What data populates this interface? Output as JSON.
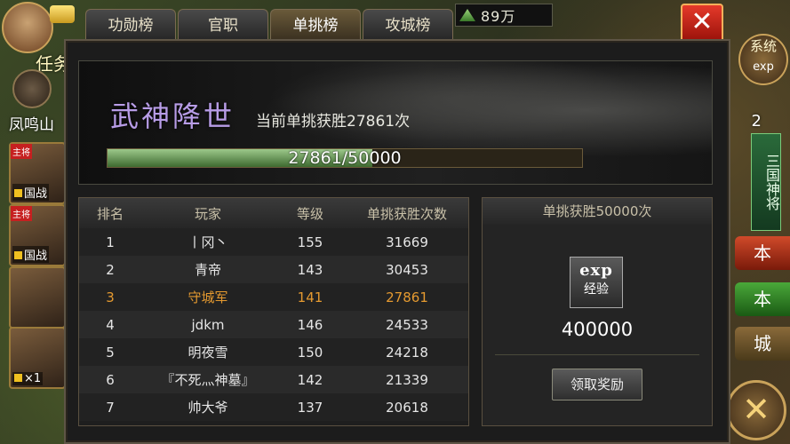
{
  "tabs": [
    {
      "label": "功勋榜",
      "active": false
    },
    {
      "label": "官职",
      "active": false
    },
    {
      "label": "单挑榜",
      "active": true
    },
    {
      "label": "攻城榜",
      "active": false
    }
  ],
  "resources": {
    "value": "89万"
  },
  "left_panel": {
    "task_label": "任务",
    "location": "凤鸣山"
  },
  "heroes": [
    {
      "badge": "主将",
      "tag": "国战"
    },
    {
      "badge": "主将",
      "tag": "国战"
    },
    {
      "badge": "",
      "tag": ""
    },
    {
      "badge": "",
      "tag": "×1"
    }
  ],
  "right_panel": {
    "system_label": "系统",
    "exp_label": "exp",
    "count": "2",
    "shen_jiang": "三国神将",
    "tabs": [
      "本",
      "本",
      "城"
    ]
  },
  "banner": {
    "title": "武神降世",
    "wins_text": "当前单挑获胜27861次",
    "progress": {
      "current": 27861,
      "max": 50000,
      "label": "27861/50000"
    }
  },
  "ranking": {
    "columns": [
      "排名",
      "玩家",
      "等级",
      "单挑获胜次数"
    ],
    "rows": [
      {
        "rank": "1",
        "player": "丨冈丶",
        "level": "155",
        "wins": "31669",
        "highlight": false
      },
      {
        "rank": "2",
        "player": "青帝",
        "level": "143",
        "wins": "30453",
        "highlight": false
      },
      {
        "rank": "3",
        "player": "守城军",
        "level": "141",
        "wins": "27861",
        "highlight": true
      },
      {
        "rank": "4",
        "player": "jdkm",
        "level": "146",
        "wins": "24533",
        "highlight": false
      },
      {
        "rank": "5",
        "player": "明夜雪",
        "level": "150",
        "wins": "24218",
        "highlight": false
      },
      {
        "rank": "6",
        "player": "『不死灬神墓』",
        "level": "142",
        "wins": "21339",
        "highlight": false
      },
      {
        "rank": "7",
        "player": "帅大爷",
        "level": "137",
        "wins": "20618",
        "highlight": false
      }
    ]
  },
  "reward": {
    "header": "单挑获胜50000次",
    "item_name": "exp",
    "item_label": "经验",
    "amount": "400000",
    "claim_label": "领取奖励"
  },
  "close_label": "✕",
  "colors": {
    "highlight": "#e59a30",
    "title": "#b79ce6",
    "progress": "#6a9a58"
  }
}
